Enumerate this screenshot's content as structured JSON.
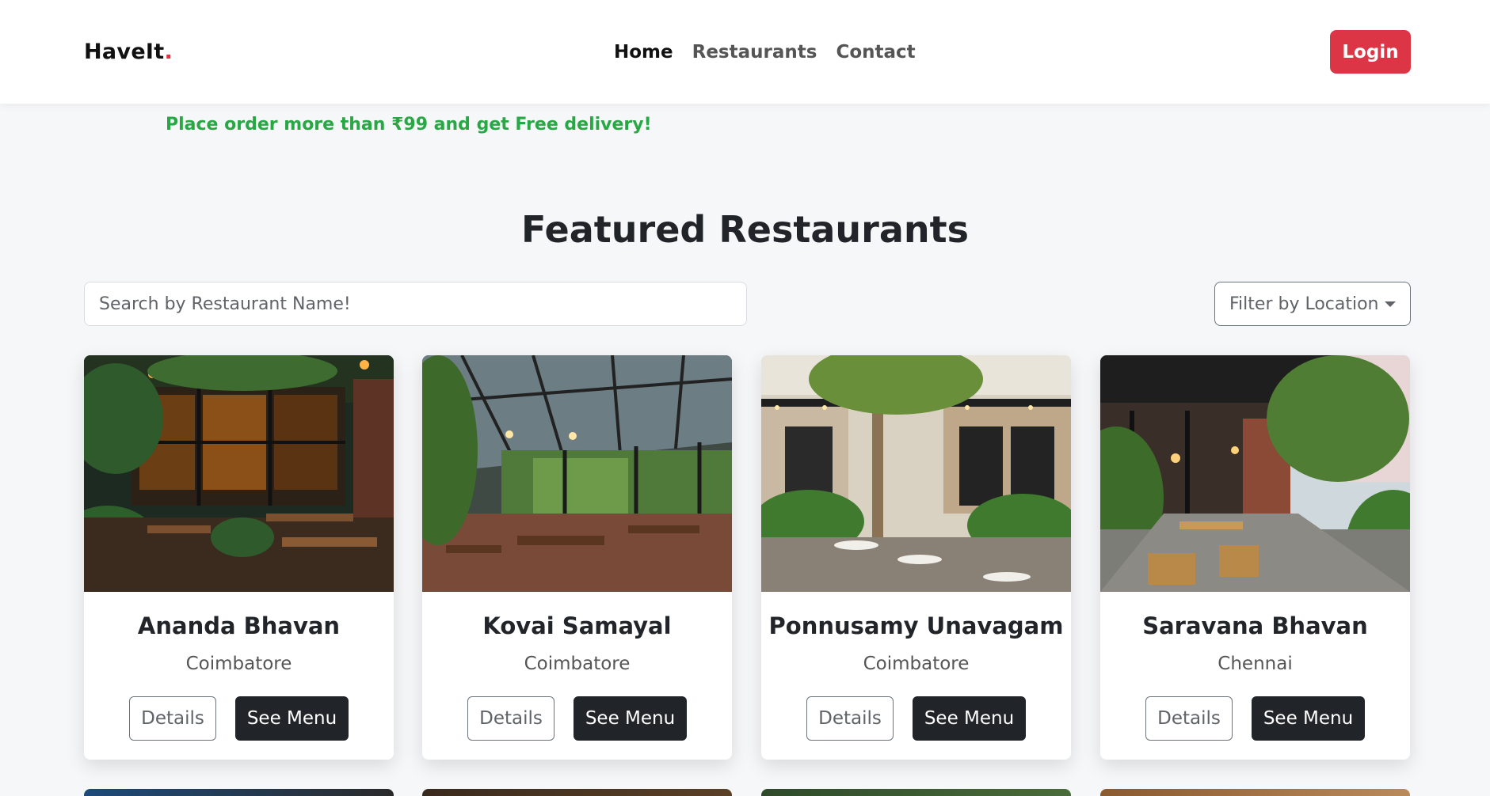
{
  "nav": {
    "brand": "HaveIt",
    "brand_dot": ".",
    "links": [
      {
        "label": "Home",
        "active": true
      },
      {
        "label": "Restaurants",
        "active": false
      },
      {
        "label": "Contact",
        "active": false
      }
    ],
    "login_label": "Login"
  },
  "promo_text": "Place order more than ₹99 and get Free delivery!",
  "section_title": "Featured Restaurants",
  "search": {
    "placeholder": "Search by Restaurant Name!"
  },
  "filter": {
    "label": "Filter by Location"
  },
  "restaurants": [
    {
      "name": "Ananda Bhavan",
      "location": "Coimbatore",
      "details_label": "Details",
      "menu_label": "See Menu"
    },
    {
      "name": "Kovai Samayal",
      "location": "Coimbatore",
      "details_label": "Details",
      "menu_label": "See Menu"
    },
    {
      "name": "Ponnusamy Unavagam",
      "location": "Coimbatore",
      "details_label": "Details",
      "menu_label": "See Menu"
    },
    {
      "name": "Saravana Bhavan",
      "location": "Chennai",
      "details_label": "Details",
      "menu_label": "See Menu"
    }
  ],
  "colors": {
    "brand_accent": "#dc3545",
    "promo": "#28a745",
    "dark_button": "#212529",
    "page_bg": "#f6f7f9"
  }
}
